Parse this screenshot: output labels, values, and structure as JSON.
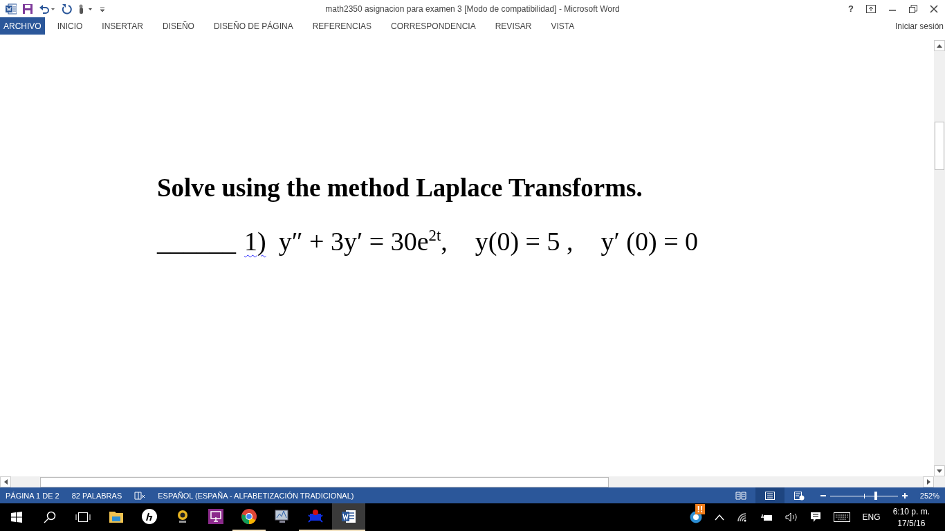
{
  "window": {
    "title": "math2350 asignacion para examen 3 [Modo de compatibilidad] - Microsoft Word",
    "help": "?"
  },
  "ribbon": {
    "tabs": [
      {
        "label": "ARCHIVO",
        "selected": true
      },
      {
        "label": "INICIO",
        "selected": false
      },
      {
        "label": "INSERTAR",
        "selected": false
      },
      {
        "label": "DISEÑO",
        "selected": false
      },
      {
        "label": "DISEÑO DE PÁGINA",
        "selected": false
      },
      {
        "label": "REFERENCIAS",
        "selected": false
      },
      {
        "label": "CORRESPONDENCIA",
        "selected": false
      },
      {
        "label": "REVISAR",
        "selected": false
      },
      {
        "label": "VISTA",
        "selected": false
      }
    ],
    "sign_in": "Iniciar sesión"
  },
  "document": {
    "heading": "Solve using the method Laplace Transforms.",
    "problem": {
      "blank": "______",
      "number": "1)",
      "equation": "y″ + 3y′ = 30e$^{2t}$,",
      "conditions": [
        "y(0) = 5 ,",
        "y′ (0) = 0"
      ]
    }
  },
  "status_bar": {
    "page": "PÁGINA 1 DE 2",
    "words": "82 PALABRAS",
    "language": "ESPAÑOL (ESPAÑA - ALFABETIZACIÓN TRADICIONAL)",
    "views": [
      {
        "kind": "read",
        "selected": false
      },
      {
        "kind": "print",
        "selected": true
      },
      {
        "kind": "web",
        "selected": false
      }
    ],
    "zoom": {
      "level": 0.68,
      "reading": "252%"
    }
  },
  "taskbar": {
    "apps": [
      {
        "kind": "folder",
        "running": false,
        "selected": false
      },
      {
        "kind": "hp",
        "running": false,
        "selected": false
      },
      {
        "kind": "webcam",
        "running": false,
        "selected": false
      },
      {
        "kind": "screen",
        "running": false,
        "selected": false
      },
      {
        "kind": "chrome",
        "running": true,
        "selected": false
      },
      {
        "kind": "monitor",
        "running": false,
        "selected": false
      },
      {
        "kind": "bug",
        "running": true,
        "selected": false
      },
      {
        "kind": "word",
        "running": true,
        "selected": true
      }
    ],
    "tray": {
      "warning": "!!",
      "language": "ENG",
      "time": "6:10 p. m.",
      "date": "17/5/16"
    }
  }
}
